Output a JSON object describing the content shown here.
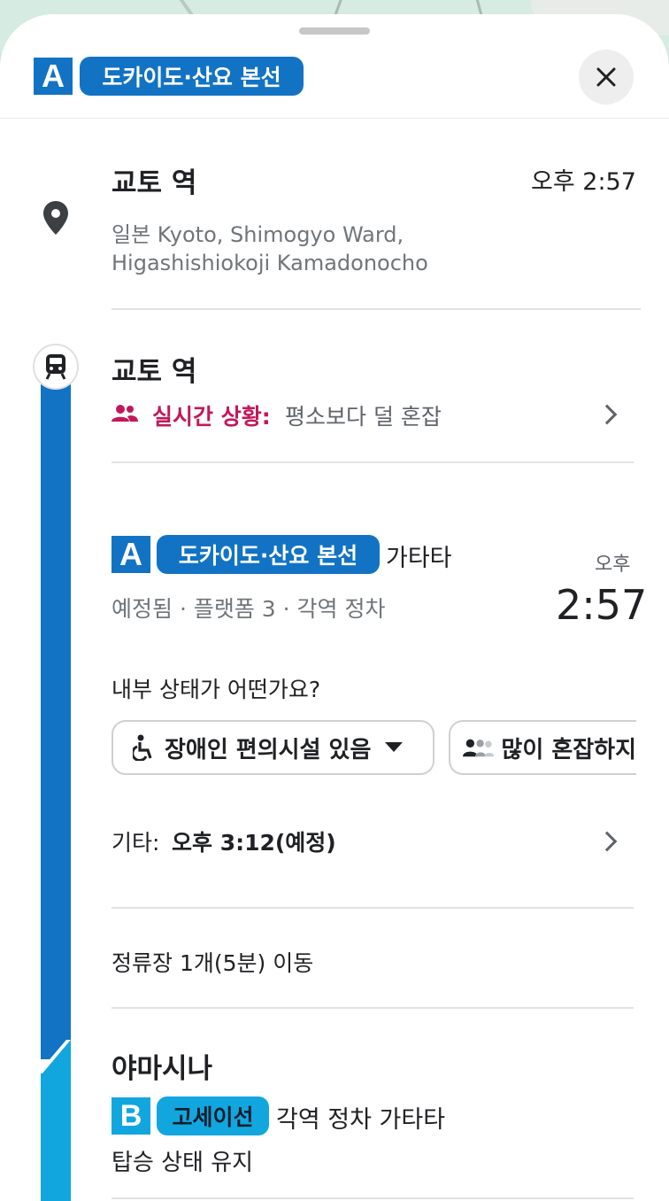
{
  "line_a": {
    "letter": "A",
    "name": "도카이도·산요 본선",
    "color": "#1273c4"
  },
  "line_b": {
    "letter": "B",
    "name": "고세이선",
    "color": "#12a6df"
  },
  "close": {
    "icon": "close-icon"
  },
  "origin": {
    "name": "교토 역",
    "time": "오후 2:57",
    "address_line1": "일본 Kyoto, Shimogyo Ward,",
    "address_line2": "Higashishiokoji Kamadonocho",
    "icon": "place-pin-icon"
  },
  "boarding": {
    "station": "교토 역",
    "realtime_label": "실시간 상황:",
    "realtime_value": "평소보다 덜 혼잡",
    "icon": "train-icon"
  },
  "leg": {
    "direction": "가타타",
    "details": "예정됨 · 플랫폼 3 · 각역 정차",
    "time_period": "오후",
    "time": "2:57",
    "question": "내부 상태가 어떤가요?",
    "chip_accessible": "장애인 편의시설 있음",
    "chip_crowd": "많이 혼잡하지",
    "other_label": "기타:",
    "other_value": "오후 3:12(예정)",
    "stops": "정류장 1개(5분) 이동"
  },
  "transfer": {
    "station": "야마시나",
    "detail": "각역 정차 가타타",
    "stay": "탑승 상태 유지"
  }
}
